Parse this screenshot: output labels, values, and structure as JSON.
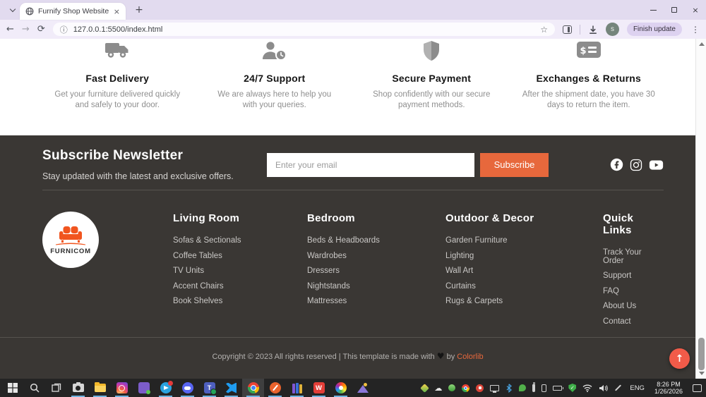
{
  "colors": {
    "accent_orange": "#e7683c",
    "scroll_top_orange": "#f15b49",
    "footer_bg": "#3a3734",
    "taskbar_bg": "#242424",
    "tabstrip_bg": "#e2dbef"
  },
  "browser": {
    "tab_title": "Furnify Shop Website",
    "url": "127.0.0.1:5500/index.html",
    "update_button_label": "Finish update",
    "avatar_letter": "s"
  },
  "glyphs": {
    "back": "←",
    "forward": "→",
    "refresh": "⟳",
    "site_info": "ⓘ",
    "star": "☆",
    "menu": "⋮",
    "tab_close": "×",
    "window_close": "×",
    "new_tab": "+",
    "scroll_top_arrow": "↑",
    "heart": "♥",
    "dollar": "$",
    "check": "✓",
    "cloud": "☁"
  },
  "features": [
    {
      "icon": "truck-icon",
      "title": "Fast Delivery",
      "desc_line1": "Get your furniture delivered quickly",
      "desc_line2": "and safely to your door."
    },
    {
      "icon": "user-clock-icon",
      "title": "24/7 Support",
      "desc_line1": "We are always here to help you",
      "desc_line2": "with your queries."
    },
    {
      "icon": "shield-icon",
      "title": "Secure Payment",
      "desc_line1": "Shop confidently with our secure",
      "desc_line2": "payment methods."
    },
    {
      "icon": "money-check-icon",
      "title": "Exchanges & Returns",
      "desc_line1": "After the shipment date, you have 30",
      "desc_line2": "days to return the item."
    }
  ],
  "newsletter": {
    "title": "Subscribe Newsletter",
    "subtitle": "Stay updated with the latest and exclusive offers.",
    "email_placeholder": "Enter your email",
    "subscribe_label": "Subscribe",
    "socials": [
      "facebook",
      "instagram",
      "youtube"
    ]
  },
  "footer": {
    "logo_text": "FURNICOM",
    "columns": [
      {
        "heading": "Living Room",
        "links": [
          "Sofas & Sectionals",
          "Coffee Tables",
          "TV Units",
          "Accent Chairs",
          "Book Shelves"
        ]
      },
      {
        "heading": "Bedroom",
        "links": [
          "Beds & Headboards",
          "Wardrobes",
          "Dressers",
          "Nightstands",
          "Mattresses"
        ]
      },
      {
        "heading": "Outdoor & Decor",
        "links": [
          "Garden Furniture",
          "Lighting",
          "Wall Art",
          "Curtains",
          "Rugs & Carpets"
        ]
      },
      {
        "heading": "Quick Links",
        "links": [
          "Track Your Order",
          "Support",
          "FAQ",
          "About Us",
          "Contact"
        ]
      }
    ],
    "copyright_pre": "Copyright © 2023 All rights reserved | This template is made with",
    "copyright_mid": "by",
    "copyright_link": "Colorlib"
  },
  "taskbar": {
    "language": "ENG",
    "time": "8:26 PM",
    "date": "1/26/2026",
    "apps": [
      "start",
      "search",
      "task-view",
      "camera",
      "file-explorer",
      "instagram",
      "purple-app",
      "telegram",
      "discord",
      "teams",
      "vscode",
      "chrome",
      "pen-app",
      "winrar",
      "wps-office",
      "photos",
      "gallery"
    ],
    "tray": [
      "diamond",
      "cloud",
      "sprout",
      "chrome",
      "screen-record",
      "monitor",
      "bluetooth",
      "leaf",
      "usb",
      "phone",
      "battery",
      "security-shield",
      "wifi",
      "volume",
      "pen",
      "language",
      "clock",
      "notifications"
    ]
  }
}
